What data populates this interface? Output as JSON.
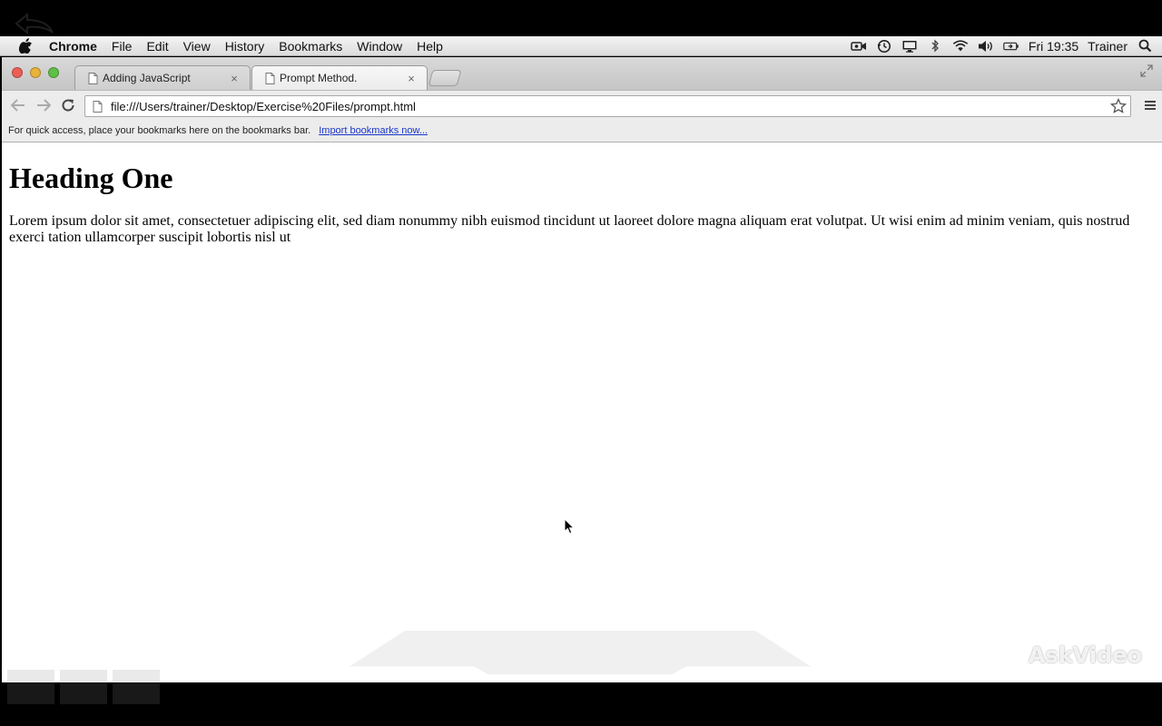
{
  "menubar": {
    "app_name": "Chrome",
    "items": [
      "File",
      "Edit",
      "View",
      "History",
      "Bookmarks",
      "Window",
      "Help"
    ],
    "clock": "Fri 19:35",
    "user": "Trainer"
  },
  "tabs": [
    {
      "title": "Adding JavaScript",
      "active": false
    },
    {
      "title": "Prompt Method.",
      "active": true
    }
  ],
  "toolbar": {
    "url": "file:///Users/trainer/Desktop/Exercise%20Files/prompt.html"
  },
  "bookmarks_bar": {
    "hint": "For quick access, place your bookmarks here on the bookmarks bar.",
    "import_link": "Import bookmarks now..."
  },
  "page": {
    "heading": "Heading One",
    "paragraph": "Lorem ipsum dolor sit amet, consectetuer adipiscing elit, sed diam nonummy nibh euismod tincidunt ut laoreet dolore magna aliquam erat volutpat. Ut wisi enim ad minim veniam, quis nostrud exerci tation ullamcorper suscipit lobortis nisl ut"
  },
  "watermark": "AskVideo",
  "colors": {
    "close_red": "#ec5f57",
    "minimize_yellow": "#e8b33c",
    "zoom_green": "#5fbf46",
    "link_blue": "#1a35c8"
  },
  "icons": {
    "apple": "apple-logo-icon",
    "status": [
      "facetime-camera-icon",
      "time-machine-icon",
      "display-icon",
      "bluetooth-icon",
      "wifi-icon",
      "volume-icon",
      "battery-icon",
      "spotlight-search-icon"
    ],
    "nav": [
      "back-arrow-icon",
      "forward-arrow-icon",
      "reload-icon"
    ],
    "omnibox": [
      "page-icon",
      "bookmark-star-icon"
    ],
    "menu": "hamburger-menu-icon"
  }
}
